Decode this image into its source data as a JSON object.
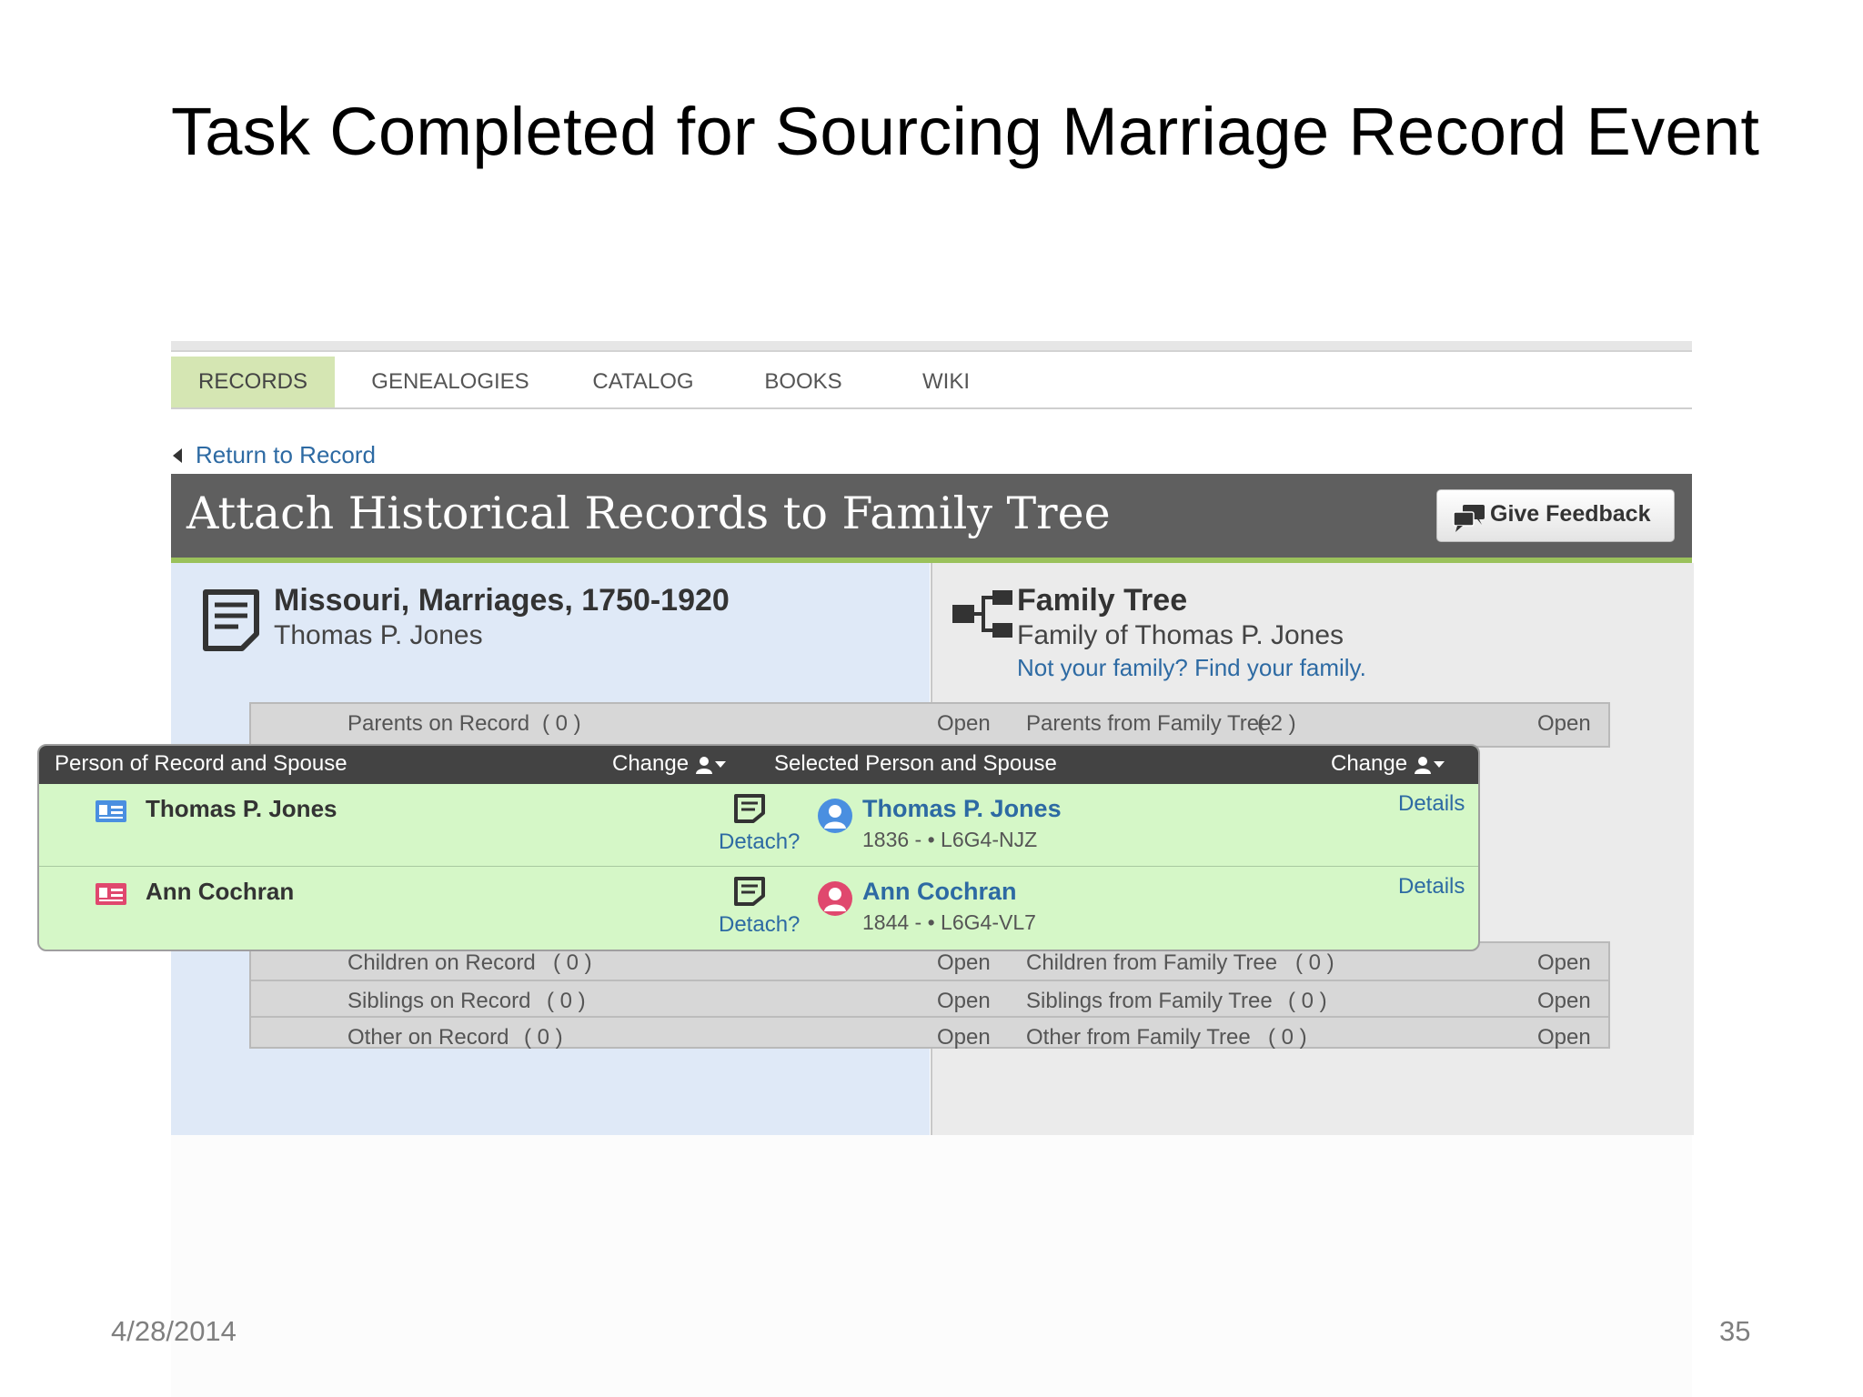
{
  "slide": {
    "title": "Task Completed for Sourcing Marriage Record Event",
    "date": "4/28/2014",
    "page_number": "35"
  },
  "nav": {
    "tabs": [
      {
        "label": "RECORDS",
        "active": true
      },
      {
        "label": "GENEALOGIES",
        "active": false
      },
      {
        "label": "CATALOG",
        "active": false
      },
      {
        "label": "BOOKS",
        "active": false
      },
      {
        "label": "WIKI",
        "active": false
      }
    ]
  },
  "return_link": "Return to Record",
  "header": {
    "title": "Attach Historical Records to Family Tree",
    "feedback_label": "Give Feedback"
  },
  "record": {
    "title": "Missouri, Marriages, 1750-1920",
    "subtitle": "Thomas P. Jones"
  },
  "tree": {
    "title": "Family Tree",
    "subtitle": "Family of Thomas P. Jones",
    "link": "Not your family? Find your family."
  },
  "parents_row": {
    "left_label": "Parents on Record",
    "left_count": "( 0 )",
    "left_action": "Open",
    "right_label": "Parents from Family Tree",
    "right_count": "( 2 )",
    "right_action": "Open"
  },
  "couple": {
    "left_header": "Person of Record and Spouse",
    "left_change": "Change",
    "right_header": "Selected Person and Spouse",
    "right_change": "Change",
    "people": [
      {
        "record_name": "Thomas P. Jones",
        "detach": "Detach?",
        "tree_name": "Thomas P. Jones",
        "tree_meta": "1836 - • L6G4-NJZ",
        "details": "Details",
        "gender_color": "#4a8fe0"
      },
      {
        "record_name": "Ann Cochran",
        "detach": "Detach?",
        "tree_name": "Ann Cochran",
        "tree_meta": "1844 - • L6G4-VL7",
        "details": "Details",
        "gender_color": "#e0486e"
      }
    ]
  },
  "other_rows": [
    {
      "left_label": "Children on Record",
      "left_count": "( 0 )",
      "left_action": "Open",
      "right_label": "Children from Family Tree",
      "right_count": "( 0 )",
      "right_action": "Open"
    },
    {
      "left_label": "Siblings on Record",
      "left_count": "( 0 )",
      "left_action": "Open",
      "right_label": "Siblings from Family Tree",
      "right_count": "( 0 )",
      "right_action": "Open"
    },
    {
      "left_label": "Other on Record",
      "left_count": "( 0 )",
      "left_action": "Open",
      "right_label": "Other from Family Tree",
      "right_count": "( 0 )",
      "right_action": "Open"
    }
  ],
  "colors": {
    "accent_green": "#9ac15b",
    "header_gray": "#5f5f5f",
    "link_blue": "#2d6aa3",
    "record_pane": "#dfe9f7",
    "couple_bg": "#d5f7c7"
  },
  "icons": [
    "caret-left-icon",
    "feedback-icon",
    "document-icon",
    "family-tree-icon",
    "person-icon",
    "id-card-icon",
    "note-icon",
    "avatar-icon"
  ]
}
